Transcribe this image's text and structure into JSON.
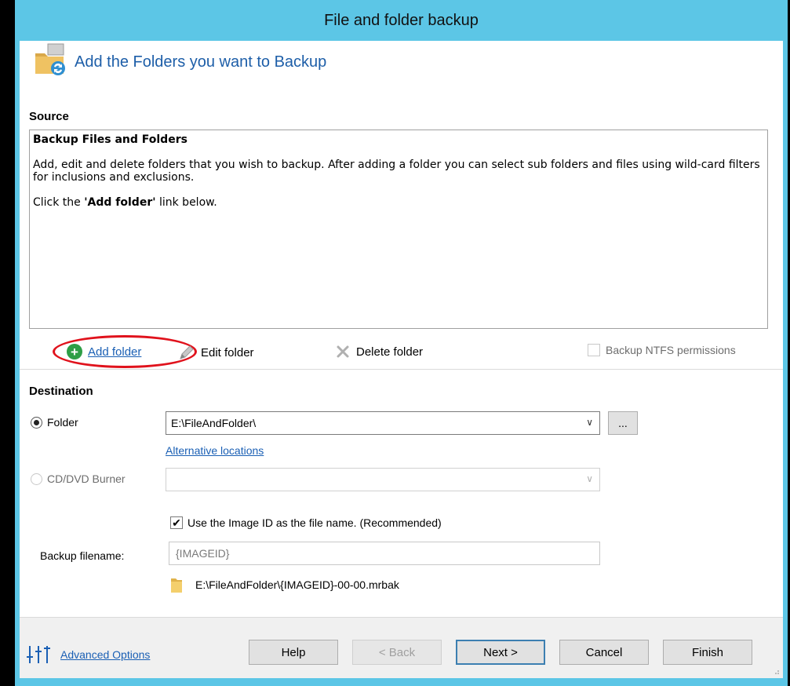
{
  "window": {
    "title": "File and folder backup"
  },
  "header": {
    "title": "Add the Folders you want to Backup",
    "icon": "folder-sync-icon"
  },
  "source": {
    "label": "Source",
    "box_title": "Backup Files and Folders",
    "description": "Add, edit and delete folders that you wish to backup. After adding a folder you can select sub folders and files using wild-card filters for inclusions and exclusions.",
    "instruction_prefix": "Click the ",
    "instruction_bold": "'Add folder'",
    "instruction_suffix": " link below."
  },
  "toolbar": {
    "add_folder": "Add folder",
    "edit_folder": "Edit folder",
    "delete_folder": "Delete folder",
    "ntfs_permissions": "Backup NTFS permissions"
  },
  "destination": {
    "label": "Destination",
    "folder_option": "Folder",
    "folder_value": "E:\\FileAndFolder\\",
    "browse_label": "...",
    "alternative_locations": "Alternative locations",
    "cd_option": "CD/DVD Burner",
    "cd_value": "",
    "use_image_id": "Use the Image ID as the file name.  (Recommended)",
    "backup_filename_label": "Backup filename:",
    "backup_filename_placeholder": "{IMAGEID}",
    "resulting_path": "E:\\FileAndFolder\\{IMAGEID}-00-00.mrbak"
  },
  "footer": {
    "advanced_options": "Advanced Options",
    "help": "Help",
    "back": "< Back",
    "next": "Next >",
    "cancel": "Cancel",
    "finish": "Finish"
  },
  "colors": {
    "title_bar": "#5cc6e6",
    "link": "#1a5fb4",
    "header_text": "#1d5ea8",
    "highlight_oval": "#e0121c"
  }
}
